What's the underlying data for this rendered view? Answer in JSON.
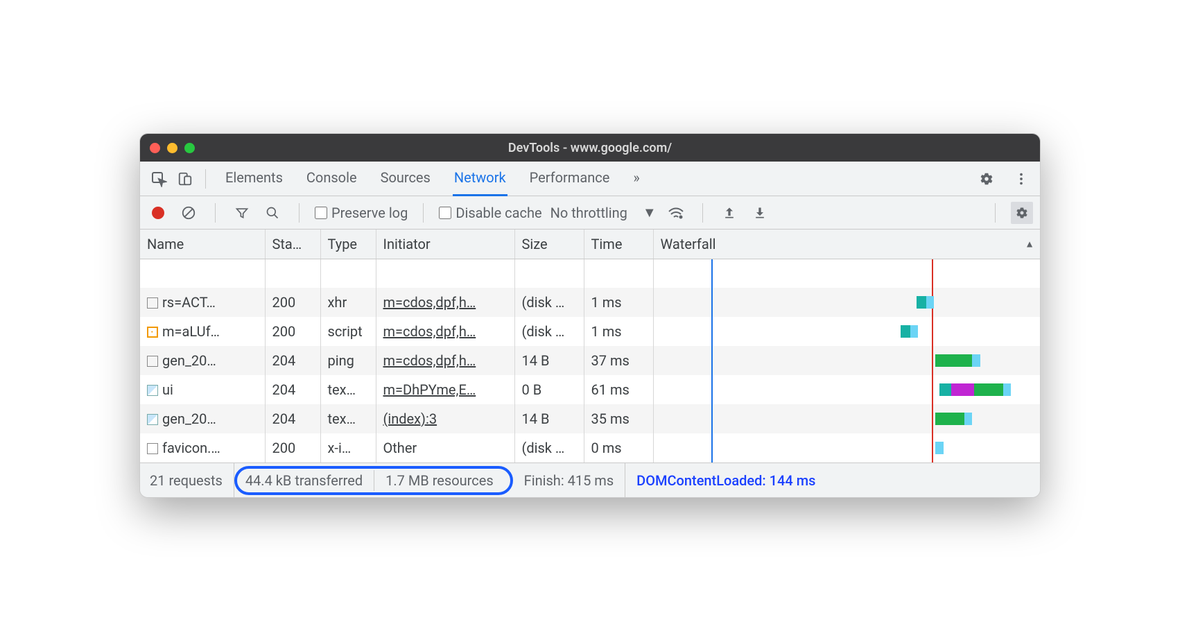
{
  "window": {
    "title": "DevTools - www.google.com/"
  },
  "tabs": {
    "items": [
      "Elements",
      "Console",
      "Sources",
      "Network",
      "Performance"
    ],
    "active": "Network",
    "overflow": "»"
  },
  "toolbar": {
    "preserve_log": "Preserve log",
    "disable_cache": "Disable cache",
    "throttling": "No throttling"
  },
  "columns": {
    "name": "Name",
    "status": "Sta…",
    "type": "Type",
    "initiator": "Initiator",
    "size": "Size",
    "time": "Time",
    "waterfall": "Waterfall"
  },
  "rows": [
    {
      "icon": "doc",
      "name": "rs=ACT…",
      "status": "200",
      "type": "xhr",
      "initiator": "m=cdos,dpf,h…",
      "initiator_link": true,
      "size": "(disk …",
      "time": "1 ms"
    },
    {
      "icon": "js",
      "name": "m=aLUf…",
      "status": "200",
      "type": "script",
      "initiator": "m=cdos,dpf,h…",
      "initiator_link": true,
      "size": "(disk …",
      "time": "1 ms"
    },
    {
      "icon": "doc",
      "name": "gen_20…",
      "status": "204",
      "type": "ping",
      "initiator": "m=cdos,dpf,h…",
      "initiator_link": true,
      "size": "14 B",
      "time": "37 ms"
    },
    {
      "icon": "img",
      "name": "ui",
      "status": "204",
      "type": "tex…",
      "initiator": "m=DhPYme,E…",
      "initiator_link": true,
      "size": "0 B",
      "time": "61 ms"
    },
    {
      "icon": "img",
      "name": "gen_20…",
      "status": "204",
      "type": "tex…",
      "initiator": "(index):3",
      "initiator_link": true,
      "size": "14 B",
      "time": "35 ms"
    },
    {
      "icon": "doc",
      "name": "favicon.…",
      "status": "200",
      "type": "x-i…",
      "initiator": "Other",
      "initiator_link": false,
      "size": "(disk …",
      "time": "0 ms"
    }
  ],
  "waterfall": {
    "blue_line_pct": 15,
    "red_line_pct": 72,
    "segments": [
      [
        {
          "l": 68,
          "w": 3,
          "c": "#17b1a4"
        },
        {
          "l": 70.5,
          "w": 2,
          "c": "#6bd4f5"
        }
      ],
      [
        {
          "l": 64,
          "w": 3,
          "c": "#17b1a4"
        },
        {
          "l": 66.5,
          "w": 2,
          "c": "#6bd4f5"
        }
      ],
      [
        {
          "l": 73,
          "w": 10,
          "c": "#1eb24c"
        },
        {
          "l": 82.5,
          "w": 2,
          "c": "#6bd4f5"
        }
      ],
      [
        {
          "l": 74,
          "w": 3,
          "c": "#17b1a4"
        },
        {
          "l": 77,
          "w": 6,
          "c": "#c026d3"
        },
        {
          "l": 83,
          "w": 8,
          "c": "#1eb24c"
        },
        {
          "l": 90.5,
          "w": 2,
          "c": "#6bd4f5"
        }
      ],
      [
        {
          "l": 73,
          "w": 8,
          "c": "#1eb24c"
        },
        {
          "l": 80.5,
          "w": 2,
          "c": "#6bd4f5"
        }
      ],
      [
        {
          "l": 73,
          "w": 2,
          "c": "#6bd4f5"
        }
      ]
    ]
  },
  "summary": {
    "requests": "21 requests",
    "transferred": "44.4 kB transferred",
    "resources": "1.7 MB resources",
    "finish": "Finish: 415 ms",
    "dcl": "DOMContentLoaded: 144 ms"
  }
}
